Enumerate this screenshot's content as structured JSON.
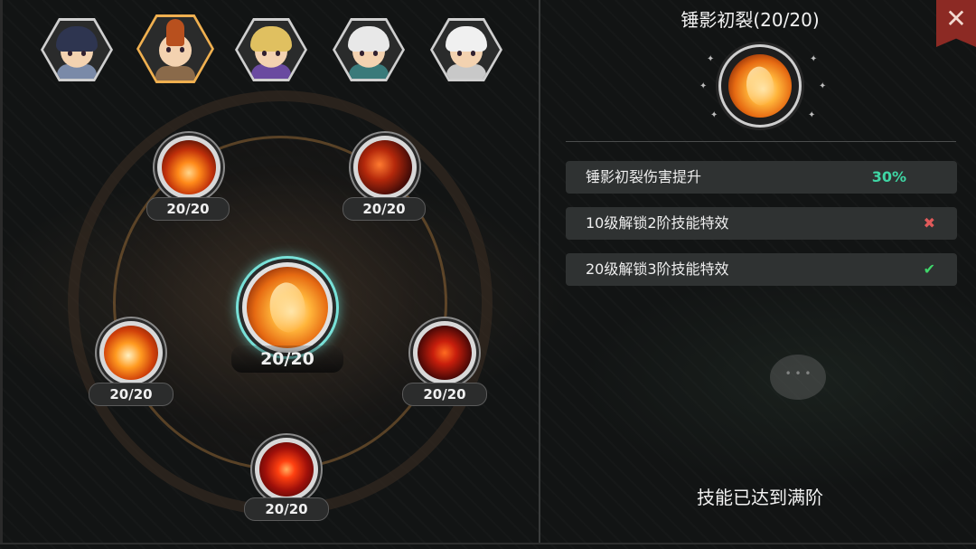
{
  "characters": [
    {
      "id": "char-1",
      "hair_color": "#2e3550",
      "body_color": "#7a8aa8",
      "selected": false
    },
    {
      "id": "char-2",
      "hair_color": "#b8501e",
      "body_color": "#8a6a4a",
      "selected": true
    },
    {
      "id": "char-3",
      "hair_color": "#e0c060",
      "body_color": "#6a4aa0",
      "selected": false
    },
    {
      "id": "char-4",
      "hair_color": "#e8e8e8",
      "body_color": "#3a7a7a",
      "selected": false
    },
    {
      "id": "char-5",
      "hair_color": "#f0f0f0",
      "body_color": "#c8c8c8",
      "selected": false
    }
  ],
  "skill_tree": {
    "main": {
      "level_text": "20/20"
    },
    "nodes": [
      {
        "position": "top-left",
        "level_text": "20/20"
      },
      {
        "position": "top-right",
        "level_text": "20/20"
      },
      {
        "position": "middle-left",
        "level_text": "20/20"
      },
      {
        "position": "middle-right",
        "level_text": "20/20"
      },
      {
        "position": "bottom",
        "level_text": "20/20"
      }
    ]
  },
  "detail": {
    "title": "锤影初裂(20/20)",
    "rows": [
      {
        "label": "锤影初裂伤害提升",
        "value": "30%"
      },
      {
        "label": "10级解锁2阶技能特效",
        "status": "✖",
        "status_meaning": "locked"
      },
      {
        "label": "20级解锁3阶技能特效",
        "status": "✔",
        "status_meaning": "unlocked"
      }
    ],
    "footer": "技能已达到满阶"
  },
  "close_label": "✕",
  "colors": {
    "accent_selected": "#f0b050",
    "value_green": "#3fd6a4",
    "cross_red": "#e05a5a",
    "check_green": "#3fd66a",
    "close_red": "#8c2a24"
  }
}
